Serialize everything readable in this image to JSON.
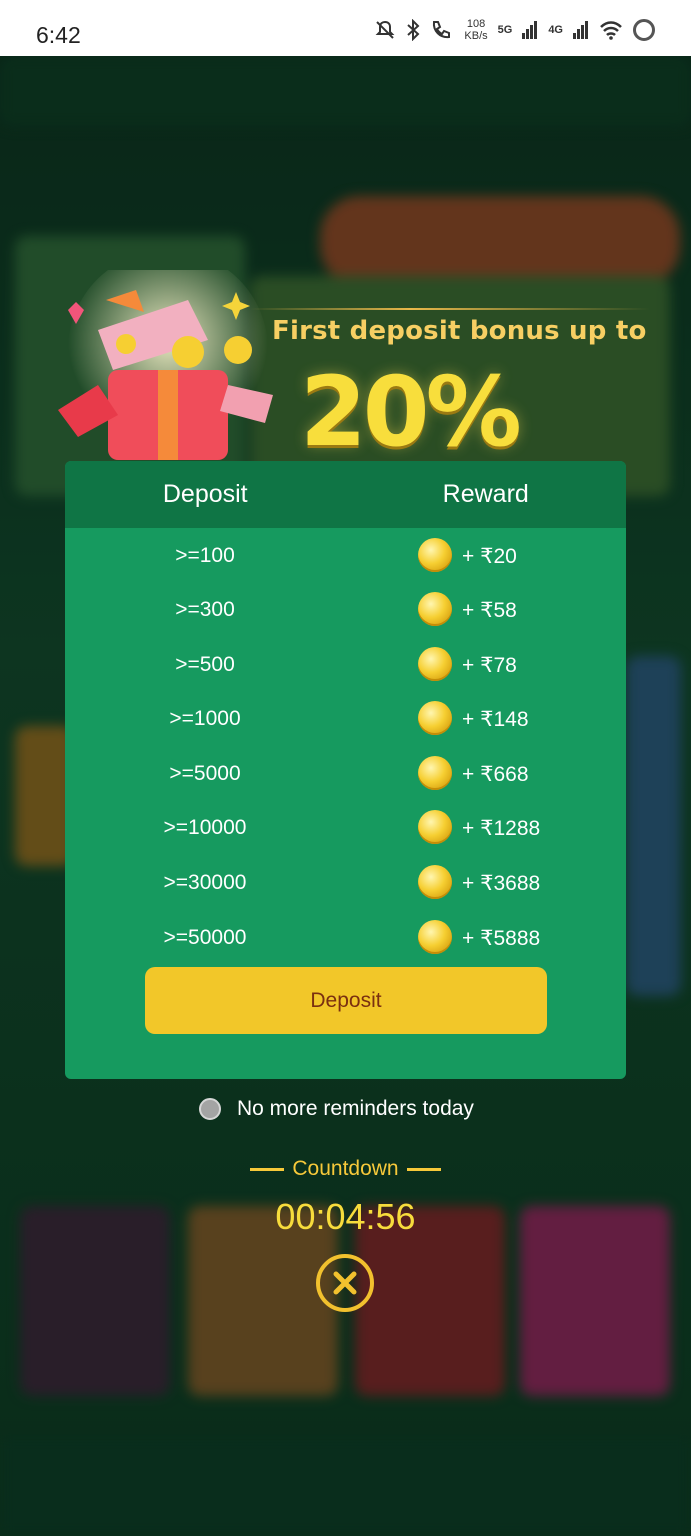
{
  "status_bar": {
    "time": "6:42",
    "speed_value": "108",
    "speed_unit": "KB/s",
    "net1": "5G",
    "net2": "4G"
  },
  "promo": {
    "headline": "First deposit bonus up to",
    "percent": "20%",
    "table": {
      "col_deposit": "Deposit",
      "col_reward": "Reward",
      "rows": [
        {
          "deposit": ">=100",
          "reward": "+ ₹20"
        },
        {
          "deposit": ">=300",
          "reward": "+ ₹58"
        },
        {
          "deposit": ">=500",
          "reward": "+ ₹78"
        },
        {
          "deposit": ">=1000",
          "reward": "+ ₹148"
        },
        {
          "deposit": ">=5000",
          "reward": "+ ₹668"
        },
        {
          "deposit": ">=10000",
          "reward": "+ ₹1288"
        },
        {
          "deposit": ">=30000",
          "reward": "+ ₹3688"
        },
        {
          "deposit": ">=50000",
          "reward": "+ ₹5888"
        }
      ]
    },
    "deposit_button": "Deposit",
    "reminder_label": "No more reminders today",
    "countdown_label": "Countdown",
    "countdown_time": "00:04:56"
  },
  "colors": {
    "card_green": "#169a5f",
    "header_green": "#0f7545",
    "button_yellow": "#f2c729",
    "gold": "#f7c93a"
  }
}
